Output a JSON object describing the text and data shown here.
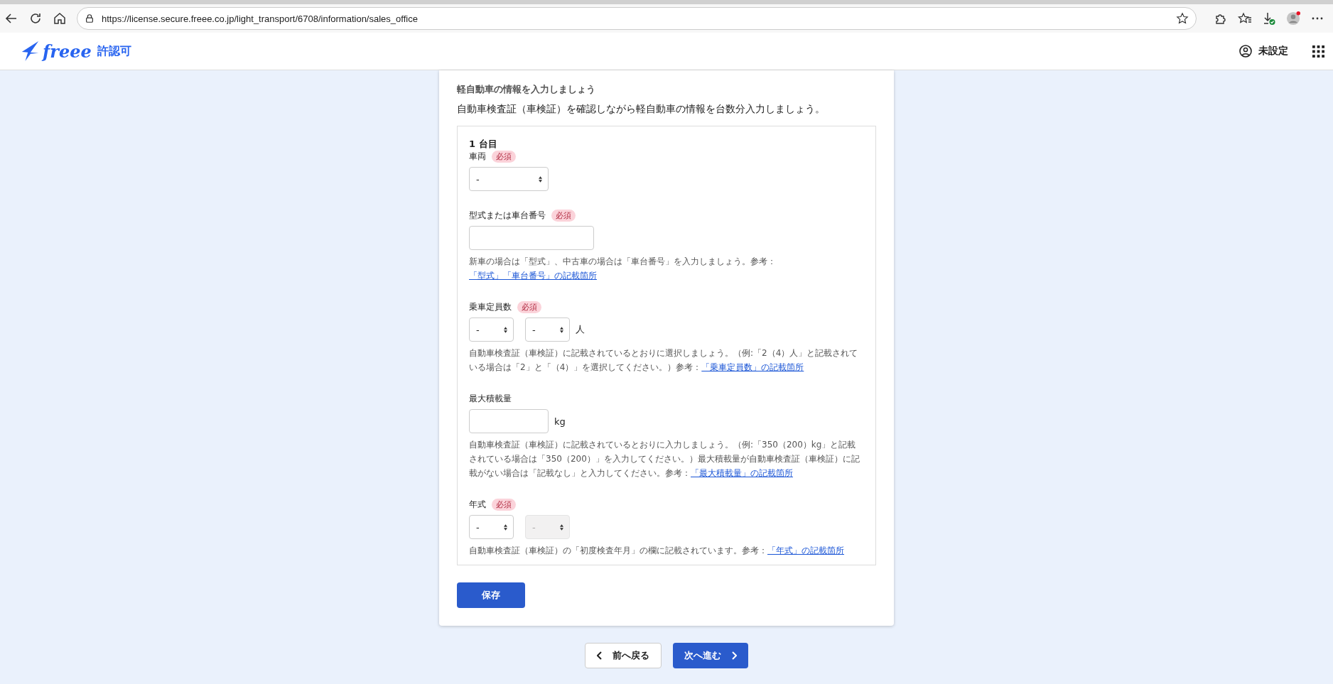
{
  "browser": {
    "url": "https://license.secure.freee.co.jp/light_transport/6708/information/sales_office"
  },
  "header": {
    "logo": "freee",
    "product": "許認可",
    "user": "未設定"
  },
  "section": {
    "title": "軽自動車の情報を入力しましょう",
    "description": "自動車検査証（車検証）を確認しながら軽自動車の情報を台数分入力しましょう。"
  },
  "vehicle": {
    "heading": "1 台目",
    "fields": [
      {
        "label": "車両",
        "required": true,
        "badge": "必須",
        "kind": "select",
        "controls": [
          {
            "value": "-",
            "disabled": false
          }
        ]
      },
      {
        "label": "型式または車台番号",
        "required": true,
        "badge": "必須",
        "kind": "text",
        "help": {
          "text": "新車の場合は「型式」、中古車の場合は「車台番号」を入力しましょう。参考：",
          "link": "「型式」「車台番号」の記載箇所"
        }
      },
      {
        "label": "乗車定員数",
        "required": true,
        "badge": "必須",
        "kind": "select-pair",
        "unit": "人",
        "controls": [
          {
            "value": "-",
            "disabled": false
          },
          {
            "value": "-",
            "disabled": false
          }
        ],
        "help": {
          "text": "自動車検査証（車検証）に記載されているとおりに選択しましょう。（例:「2（4）人」と記載されている場合は「2」と「（4）」を選択してください。）参考：",
          "link": "「乗車定員数」の記載箇所"
        }
      },
      {
        "label": "最大積載量",
        "required": false,
        "kind": "text",
        "unit": "kg",
        "help": {
          "text": "自動車検査証（車検証）に記載されているとおりに入力しましょう。（例:「350（200）kg」と記載されている場合は「350（200）」を入力してください。）最大積載量が自動車検査証（車検証）に記載がない場合は「記載なし」と入力してください。参考：",
          "link": "「最大積載量」の記載箇所"
        }
      },
      {
        "label": "年式",
        "required": true,
        "badge": "必須",
        "kind": "select-pair",
        "controls": [
          {
            "value": "-",
            "disabled": false
          },
          {
            "value": "-",
            "disabled": true
          }
        ],
        "help": {
          "text": "自動車検査証（車検証）の「初度検査年月」の欄に記載されています。参考：",
          "link": "「年式」の記載箇所"
        }
      }
    ]
  },
  "save_button": "保存",
  "nav": {
    "back": "前へ戻る",
    "next": "次へ進む"
  }
}
